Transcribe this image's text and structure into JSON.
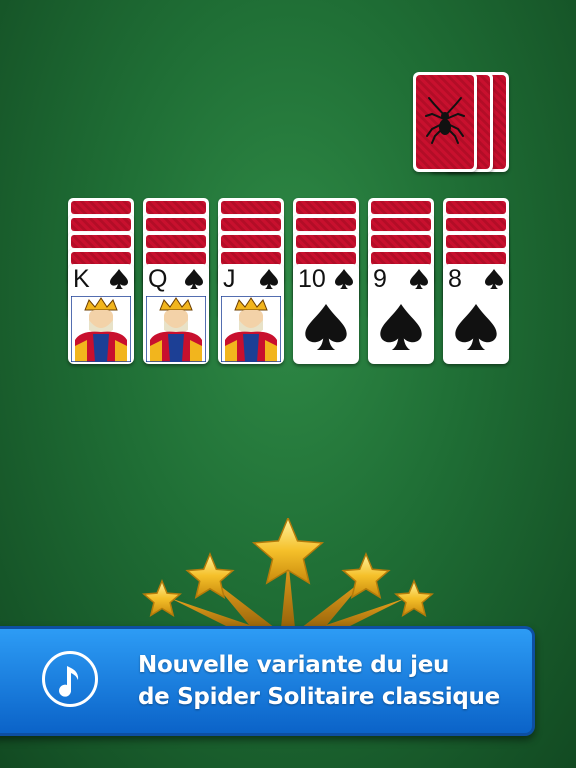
{
  "stock": {
    "icon": "spider-icon",
    "card_back_color": "#c8102e",
    "visible_backs": 3
  },
  "tableau": {
    "columns": [
      {
        "rank": "K",
        "suit": "spade",
        "court": "king"
      },
      {
        "rank": "Q",
        "suit": "spade",
        "court": "queen"
      },
      {
        "rank": "J",
        "suit": "spade",
        "court": "jack"
      },
      {
        "rank": "10",
        "suit": "spade",
        "court": ""
      },
      {
        "rank": "9",
        "suit": "spade",
        "court": ""
      },
      {
        "rank": "8",
        "suit": "spade",
        "court": ""
      }
    ],
    "face_down_per_column": 4
  },
  "banner": {
    "line1": "Nouvelle variante du jeu",
    "line2": "de Spider Solitaire classique",
    "icon": "music-note-icon",
    "color": "#1a7fe0"
  },
  "colors": {
    "table": "#1f6e35",
    "card_back": "#c8102e",
    "star": "#f5c02a"
  }
}
